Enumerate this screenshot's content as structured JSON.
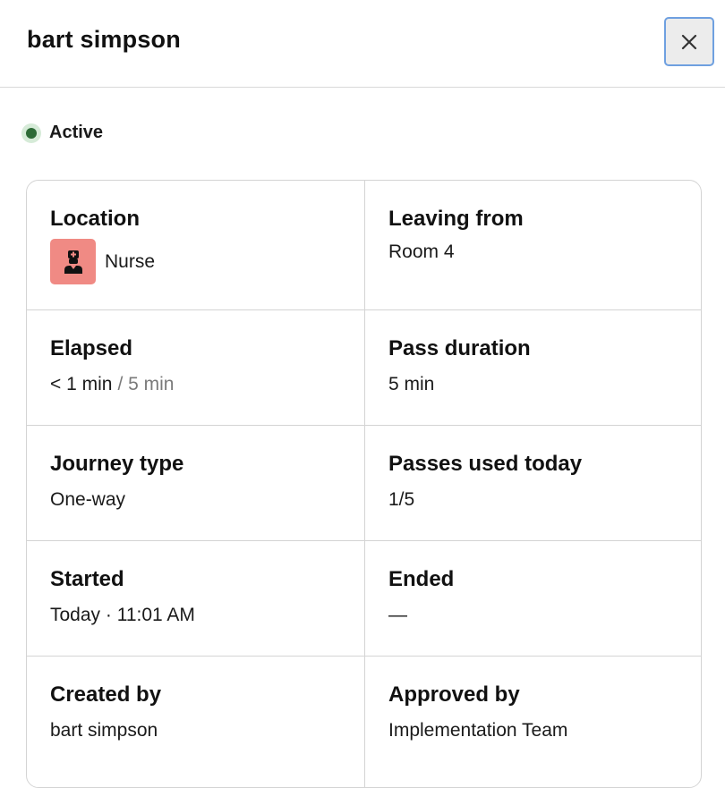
{
  "header": {
    "title": "bart simpson"
  },
  "status": {
    "label": "Active",
    "color": "#2e6b37"
  },
  "details": {
    "location": {
      "label": "Location",
      "value": "Nurse",
      "icon": "nurse-icon",
      "icon_color": "#f08a84"
    },
    "leaving_from": {
      "label": "Leaving from",
      "value": "Room 4"
    },
    "elapsed": {
      "label": "Elapsed",
      "value": "< 1 min",
      "limit": "/ 5 min"
    },
    "pass_duration": {
      "label": "Pass duration",
      "value": "5 min"
    },
    "journey_type": {
      "label": "Journey type",
      "value": "One-way"
    },
    "passes_used_today": {
      "label": "Passes used today",
      "value": "1/5"
    },
    "started": {
      "label": "Started",
      "value": "Today · 11:01 AM"
    },
    "ended": {
      "label": "Ended",
      "value": "—"
    },
    "created_by": {
      "label": "Created by",
      "value": "bart simpson"
    },
    "approved_by": {
      "label": "Approved by",
      "value": "Implementation Team"
    }
  }
}
